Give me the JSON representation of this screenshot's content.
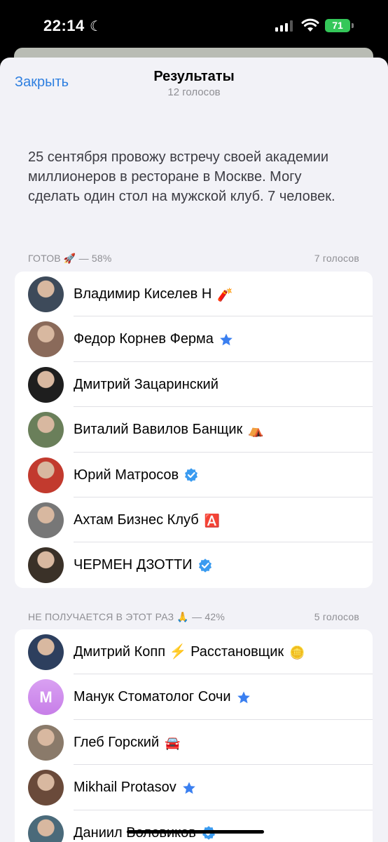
{
  "status": {
    "time": "22:14",
    "battery": "71"
  },
  "header": {
    "close_label": "Закрыть",
    "title": "Результаты",
    "subtitle": "12 голосов"
  },
  "poll": {
    "question": "25 сентября провожу встречу своей академии миллионеров в ресторане в Москве. Могу сделать один стол на мужской клуб. 7 человек."
  },
  "options": [
    {
      "label": "ГОТОВ 🚀 — 58%",
      "votes": "7 голосов",
      "voters": [
        {
          "name": "Владимир Киселев Н",
          "badge": "🧨",
          "avatar_color": "#3d4a5a"
        },
        {
          "name": "Федор Корнев Ферма",
          "badge": "⭐",
          "avatar_color": "#8a6a5a"
        },
        {
          "name": "Дмитрий Зацаринский",
          "badge": "",
          "avatar_color": "#1e1e1e"
        },
        {
          "name": "Виталий Вавилов Банщик",
          "badge": "⛺",
          "avatar_color": "#6a7f5a"
        },
        {
          "name": "Юрий Матросов",
          "badge": "verified",
          "avatar_color": "#c23a2e"
        },
        {
          "name": "Ахтам Бизнес Клуб",
          "badge": "🅰️",
          "avatar_color": "#777777"
        },
        {
          "name": "ЧЕРМЕН ДЗОТТИ",
          "badge": "verified",
          "avatar_color": "#3a3128"
        }
      ]
    },
    {
      "label": "НЕ ПОЛУЧАЕТСЯ В ЭТОТ РАЗ 🙏 — 42%",
      "votes": "5 голосов",
      "voters": [
        {
          "name": "Дмитрий Копп ⚡ Расстановщик",
          "badge": "🪙",
          "avatar_color": "#2d3f5e"
        },
        {
          "name": "Манук Стоматолог Сочи",
          "badge": "⭐",
          "avatar_color": "#c77ee8",
          "initial": "М"
        },
        {
          "name": "Глеб Горский",
          "badge": "🚘",
          "avatar_color": "#8a7a6a"
        },
        {
          "name": "Mikhail Protasov",
          "badge": "⭐",
          "avatar_color": "#6a4a3a"
        },
        {
          "name": "Даниил Воловиков",
          "badge": "verified",
          "avatar_color": "#4a6a7a"
        }
      ]
    }
  ],
  "colors": {
    "accent": "#2e7fe0",
    "verified": "#3a9bf0",
    "star": "#3a7ff0",
    "battery": "#34c759"
  }
}
